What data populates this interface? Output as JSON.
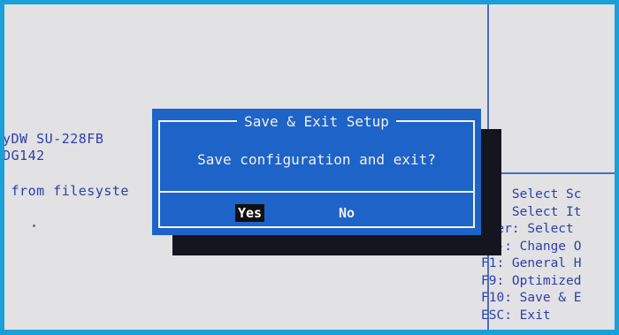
{
  "background_text": {
    "device_line": "yDW SU-228FB",
    "device_line2": "DG142",
    "boot_line": " from filesyste"
  },
  "dialog": {
    "title": "Save & Exit Setup",
    "message": "Save configuration and exit?",
    "yes_label": "Yes",
    "no_label": "No"
  },
  "help": {
    "lines": [
      "→←: Select Sc",
      " ↓: Select It",
      "nter: Select",
      "+/-: Change O",
      "F1: General H",
      "F9: Optimized",
      "F10: Save & E",
      "ESC: Exit"
    ]
  },
  "colors": {
    "dialog_bg": "#1e63c7",
    "screen_bg": "#e2e1e4",
    "bios_text": "#2e3fa6",
    "border": "#1a9fd8"
  }
}
